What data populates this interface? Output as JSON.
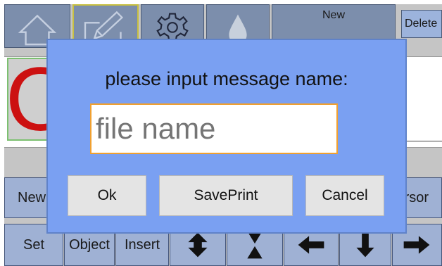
{
  "toolbar": {
    "icons": [
      "home-icon",
      "edit-icon",
      "gear-icon",
      "ink-drop-icon"
    ],
    "new_label": "New",
    "delete_label": "Delete"
  },
  "preview": {
    "glyph": "O",
    "glyph_color": "#cc1111"
  },
  "midbar": {
    "new_label": "New",
    "cursor_label": "Cursor"
  },
  "bottombar": {
    "set_label": "Set",
    "object_label": "Object",
    "insert_label": "Insert",
    "icons": [
      "vertical-expand-icon",
      "vertical-compress-icon",
      "arrow-left-icon",
      "arrow-down-icon",
      "arrow-right-icon"
    ]
  },
  "dialog": {
    "prompt": "please input message name:",
    "input_placeholder": "file name",
    "input_value": "",
    "ok_label": "Ok",
    "saveprint_label": "SavePrint",
    "cancel_label": "Cancel"
  },
  "colors": {
    "dialog_bg": "#7aa0f2",
    "toolbar_bg": "#7c8eac",
    "button_bg": "#9fb1d4",
    "input_border": "#f0a030"
  }
}
